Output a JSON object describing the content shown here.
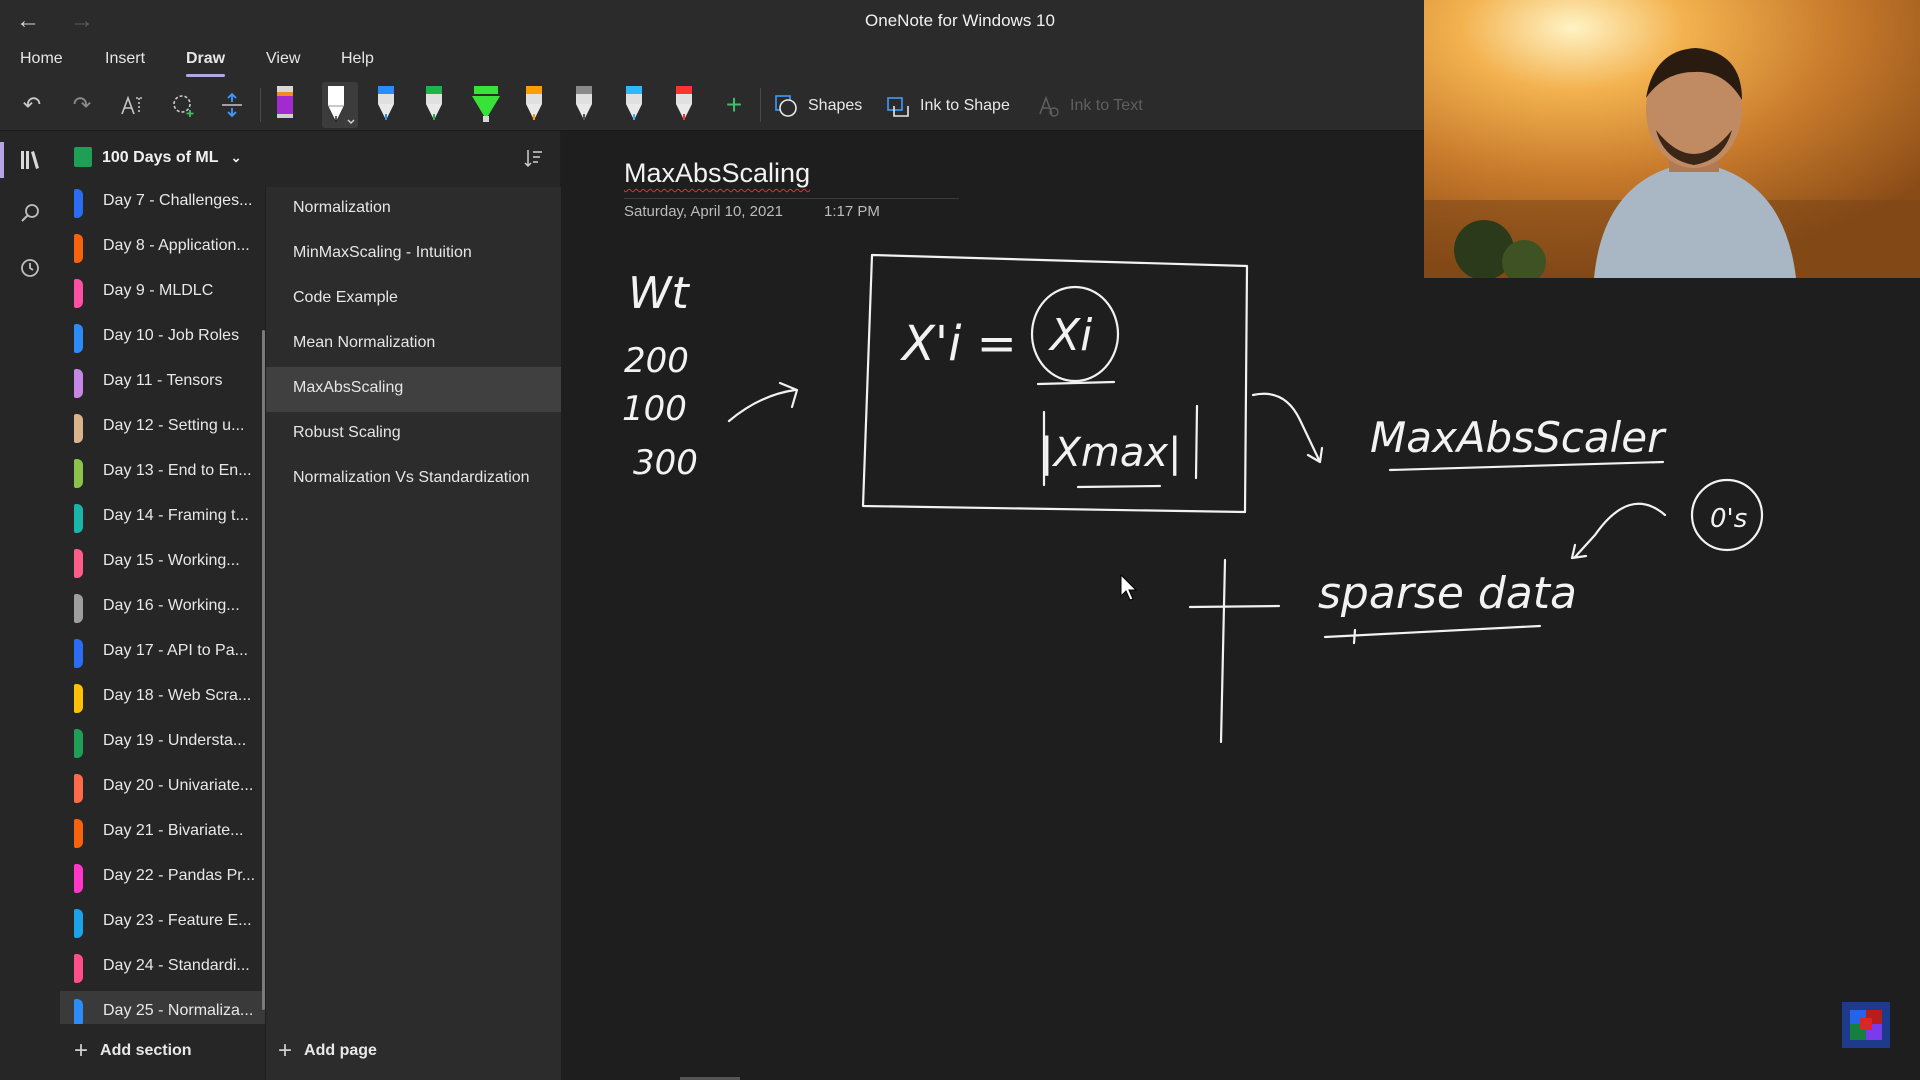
{
  "window": {
    "title": "OneNote for Windows 10",
    "back_icon": "arrow-left-icon",
    "forward_icon": "arrow-right-icon"
  },
  "menu": {
    "items": [
      "Home",
      "Insert",
      "Draw",
      "View",
      "Help"
    ],
    "active": "Draw"
  },
  "toolbar": {
    "shapes_label": "Shapes",
    "ink_to_shape_label": "Ink to Shape",
    "ink_to_text_label": "Ink to Text",
    "pen_colors": [
      "#a12bd1",
      "#ffffff",
      "#2a8cff",
      "#1fb34a",
      "#39e239",
      "#ff9d00",
      "#d9d9d9",
      "#2fb8ff",
      "#ff3333"
    ]
  },
  "notebook": {
    "name": "100 Days of ML",
    "color": "#1f9e55"
  },
  "sections": [
    {
      "label": "Day 7 - Challenges...",
      "color": "#2a6df4"
    },
    {
      "label": "Day 8 - Application...",
      "color": "#f7630c"
    },
    {
      "label": "Day 9 - MLDLC",
      "color": "#ff4fa3"
    },
    {
      "label": "Day 10 - Job Roles",
      "color": "#2b8cf7"
    },
    {
      "label": "Day 11 - Tensors",
      "color": "#c586e6"
    },
    {
      "label": "Day 12 - Setting u...",
      "color": "#d8b48a"
    },
    {
      "label": "Day 13 - End to En...",
      "color": "#8bc34a"
    },
    {
      "label": "Day 14 - Framing t...",
      "color": "#19b5a8"
    },
    {
      "label": "Day 15 - Working...",
      "color": "#ff5c8a"
    },
    {
      "label": "Day 16 - Working...",
      "color": "#9e9e9e"
    },
    {
      "label": "Day 17 - API to Pa...",
      "color": "#2a6df4"
    },
    {
      "label": "Day 18 - Web Scra...",
      "color": "#ffc107"
    },
    {
      "label": "Day 19 - Understa...",
      "color": "#1f9e55"
    },
    {
      "label": "Day 20 - Univariate...",
      "color": "#ff6b4a"
    },
    {
      "label": "Day 21 - Bivariate...",
      "color": "#f7630c"
    },
    {
      "label": "Day 22 - Pandas Pr...",
      "color": "#ff36c8"
    },
    {
      "label": "Day 23 - Feature E...",
      "color": "#1aa3e8"
    },
    {
      "label": "Day 24 - Standardi...",
      "color": "#ff4f8b"
    },
    {
      "label": "Day 25 - Normaliza...",
      "color": "#2b8cf7"
    }
  ],
  "active_section": "Day 25 - Normaliza...",
  "pages": [
    "Normalization",
    "MinMaxScaling - Intuition",
    "Code Example",
    "Mean Normalization",
    "MaxAbsScaling",
    "Robust Scaling",
    "Normalization Vs Standardization"
  ],
  "active_page": "MaxAbsScaling",
  "footer": {
    "add_section": "Add section",
    "add_page": "Add page"
  },
  "page": {
    "title": "MaxAbsScaling",
    "date": "Saturday, April 10, 2021",
    "time": "1:17 PM"
  },
  "ink": {
    "column_header": "Wt",
    "column_values": [
      "200",
      "100",
      "300"
    ],
    "formula_lhs": "X'i =",
    "formula_numerator": "Xi",
    "formula_denominator": "|Xmax|",
    "label_scaler": "MaxAbsScaler",
    "label_sparse": "sparse data",
    "label_zeros": "0's"
  }
}
